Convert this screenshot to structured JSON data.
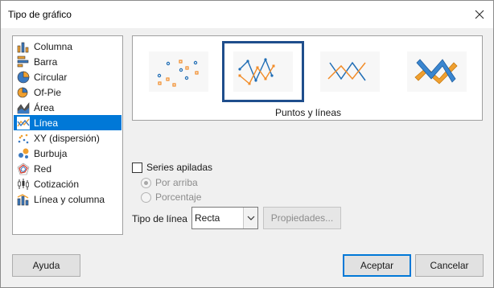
{
  "window": {
    "title": "Tipo de gráfico",
    "close_icon": "close-icon"
  },
  "chart_types": [
    {
      "label": "Columna",
      "icon": "column-chart-icon"
    },
    {
      "label": "Barra",
      "icon": "bar-chart-icon"
    },
    {
      "label": "Circular",
      "icon": "pie-chart-icon"
    },
    {
      "label": "Of-Pie",
      "icon": "of-pie-chart-icon"
    },
    {
      "label": "Área",
      "icon": "area-chart-icon"
    },
    {
      "label": "Línea",
      "icon": "line-chart-icon",
      "selected": true
    },
    {
      "label": "XY (dispersión)",
      "icon": "scatter-chart-icon"
    },
    {
      "label": "Burbuja",
      "icon": "bubble-chart-icon"
    },
    {
      "label": "Red",
      "icon": "net-chart-icon"
    },
    {
      "label": "Cotización",
      "icon": "stock-chart-icon"
    },
    {
      "label": "Línea y columna",
      "icon": "line-column-chart-icon"
    }
  ],
  "variants": {
    "items": [
      "Solo puntos",
      "Puntos y líneas",
      "Solo líneas",
      "Líneas 3D"
    ],
    "selected_index": 1,
    "caption": "Puntos y líneas"
  },
  "options": {
    "stacked_label": "Series apiladas",
    "stacked_checked": false,
    "on_top_label": "Por arriba",
    "percent_label": "Porcentaje",
    "line_type_label": "Tipo de línea",
    "line_type_value": "Recta",
    "properties_label": "Propiedades..."
  },
  "buttons": {
    "help": "Ayuda",
    "ok": "Aceptar",
    "cancel": "Cancelar"
  },
  "colors": {
    "series_orange": "#f28c28",
    "series_blue": "#1f6db5",
    "selection": "#0078d7"
  }
}
